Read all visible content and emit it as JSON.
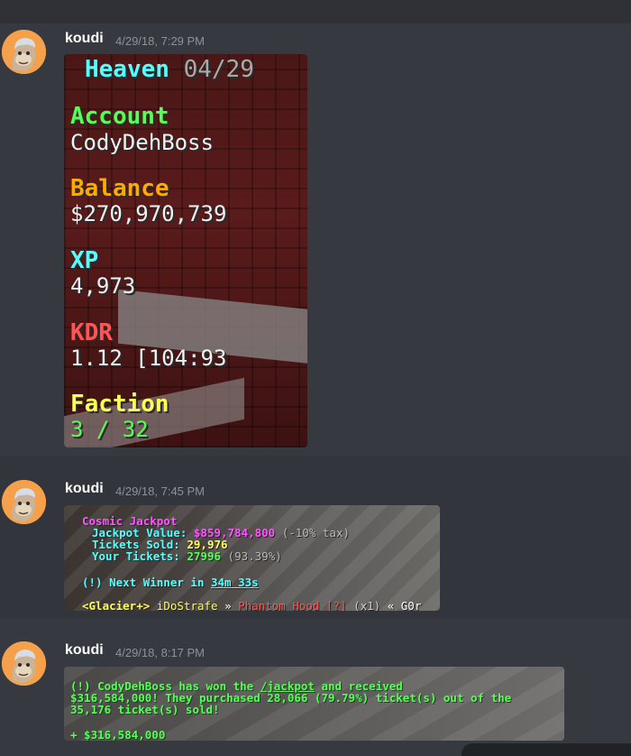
{
  "colors": {
    "background": "#36393f",
    "avatar_bg": "#f5a04a",
    "aqua": "#55ffff",
    "green": "#55ff55",
    "gold": "#ffaa00",
    "red": "#ff5555",
    "yellow": "#ffff55",
    "magenta": "#ff55ff"
  },
  "messages": [
    {
      "author": "koudi",
      "timestamp": "4/29/18, 7:29 PM",
      "scoreboard": {
        "title": "Heaven",
        "title_date": "04/29",
        "rows": [
          {
            "header": "Account",
            "value": "CodyDehBoss"
          },
          {
            "header": "Balance",
            "value": "$270,970,739"
          },
          {
            "header": "XP",
            "value": "4,973"
          },
          {
            "header": "KDR",
            "value": "1.12 [104:93"
          },
          {
            "header": "Faction",
            "value": "3 / 32"
          }
        ]
      }
    },
    {
      "author": "koudi",
      "timestamp": "4/29/18, 7:45 PM",
      "jackpot": {
        "title": "Cosmic Jackpot",
        "value_label": "Jackpot Value:",
        "value": "$859,784,800",
        "tax": "(-10% tax)",
        "sold_label": "Tickets Sold:",
        "sold": "29,976",
        "yours_label": "Your Tickets:",
        "yours": "27996",
        "yours_pct": "(93.39%)",
        "next_prefix": "(!) Next Winner in",
        "next_time": "34m 33s",
        "chat_rank": "<Glacier+>",
        "chat_name": "iDoStrafe",
        "chat_sep": "»",
        "chat_item": "Phantom Hood [?]",
        "chat_qty": "(x1)",
        "chat_tail": "« G0r"
      }
    },
    {
      "author": "koudi",
      "timestamp": "4/29/18, 8:17 PM",
      "win": {
        "line1a": "(!) CodyDehBoss has won the",
        "line1_link": "/jackpot",
        "line1b": "and received",
        "line2": "$316,584,000! They purchased 28,066 (79.79%) ticket(s) out of the",
        "line3": "35,176 ticket(s) sold!",
        "line4": "+ $316,584,000"
      }
    }
  ]
}
